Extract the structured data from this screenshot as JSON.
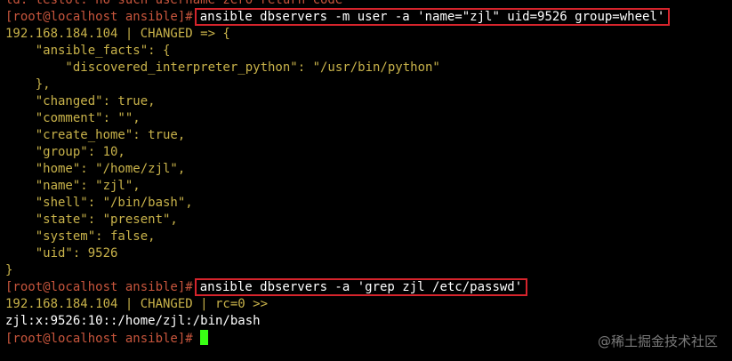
{
  "terminal": {
    "lines": [
      {
        "kind": "partial",
        "text": "ld: testol: no such username zero return code"
      },
      {
        "kind": "command",
        "prompt": "[root@localhost ansible]#",
        "command": "ansible dbservers -m user -a 'name=\"zjl\" uid=9526 group=wheel'",
        "highlighted": true
      },
      {
        "kind": "output",
        "text": "192.168.184.104 | CHANGED => {"
      },
      {
        "kind": "output",
        "text": "    \"ansible_facts\": {"
      },
      {
        "kind": "output",
        "text": "        \"discovered_interpreter_python\": \"/usr/bin/python\""
      },
      {
        "kind": "output",
        "text": "    },"
      },
      {
        "kind": "output",
        "text": "    \"changed\": true,"
      },
      {
        "kind": "output",
        "text": "    \"comment\": \"\","
      },
      {
        "kind": "output",
        "text": "    \"create_home\": true,"
      },
      {
        "kind": "output",
        "text": "    \"group\": 10,"
      },
      {
        "kind": "output",
        "text": "    \"home\": \"/home/zjl\","
      },
      {
        "kind": "output",
        "text": "    \"name\": \"zjl\","
      },
      {
        "kind": "output",
        "text": "    \"shell\": \"/bin/bash\","
      },
      {
        "kind": "output",
        "text": "    \"state\": \"present\","
      },
      {
        "kind": "output",
        "text": "    \"system\": false,"
      },
      {
        "kind": "output",
        "text": "    \"uid\": 9526"
      },
      {
        "kind": "output",
        "text": "}"
      },
      {
        "kind": "command",
        "prompt": "[root@localhost ansible]#",
        "command": "ansible dbservers -a 'grep zjl /etc/passwd'",
        "highlighted": true
      },
      {
        "kind": "output",
        "text": "192.168.184.104 | CHANGED | rc=0 >>"
      },
      {
        "kind": "plain",
        "text": "zjl:x:9526:10::/home/zjl:/bin/bash"
      },
      {
        "kind": "command",
        "prompt": "[root@localhost ansible]#",
        "command": "",
        "highlighted": false,
        "cursor": true
      }
    ]
  },
  "watermark": "@稀土掘金技术社区",
  "colors": {
    "background": "#000000",
    "prompt": "#c7553c",
    "output": "#c8b24a",
    "command": "#ffffff",
    "highlight_border": "#d6242c",
    "cursor": "#39ff14"
  }
}
